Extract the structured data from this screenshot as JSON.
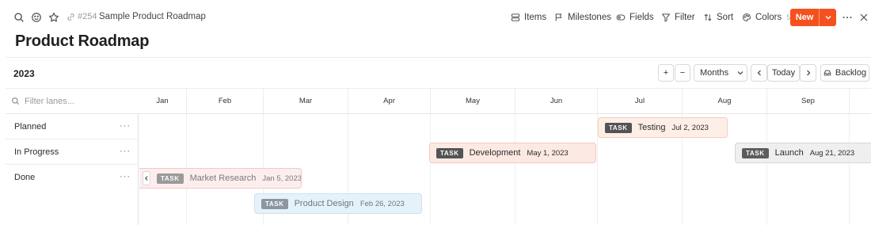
{
  "breadcrumb": {
    "page_ref": "#254",
    "title": "Sample Product Roadmap"
  },
  "toolbar": {
    "items": "Items",
    "milestones": "Milestones",
    "fields": "Fields",
    "filter": "Filter",
    "sort": "Sort",
    "colors": "Colors",
    "colors_count": "5",
    "new": "New"
  },
  "page_title": "Product Roadmap",
  "timeline": {
    "year": "2023",
    "zoom_plus": "+",
    "zoom_minus": "−",
    "scale": "Months",
    "today": "Today",
    "backlog": "Backlog",
    "filter_placeholder": "Filter lanes...",
    "months": [
      "Jan",
      "Feb",
      "Mar",
      "Apr",
      "May",
      "Jun",
      "Jul",
      "Aug",
      "Sep"
    ]
  },
  "lanes": [
    {
      "label": "Planned",
      "more": "···"
    },
    {
      "label": "In Progress",
      "more": "···"
    },
    {
      "label": "Done",
      "more": "···"
    }
  ],
  "tasks": [
    {
      "tag": "TASK",
      "name": "Testing",
      "date": "Jul 2, 2023",
      "lane": "Planned"
    },
    {
      "tag": "TASK",
      "name": "Development",
      "date": "May 1, 2023",
      "lane": "In Progress"
    },
    {
      "tag": "TASK",
      "name": "Launch",
      "date": "Aug 21, 2023",
      "lane": "In Progress"
    },
    {
      "tag": "TASK",
      "name": "Market Research",
      "date": "Jan 5, 2023",
      "lane": "Done"
    },
    {
      "tag": "TASK",
      "name": "Product Design",
      "date": "Feb 26, 2023",
      "lane": "Done"
    }
  ],
  "colors": {
    "accent": "#f4511e"
  },
  "icons": [
    "search-icon",
    "emoji-icon",
    "star-icon",
    "link-icon",
    "items-icon",
    "flag-icon",
    "fields-icon",
    "filter-icon",
    "sort-icon",
    "palette-icon",
    "chevron-down-icon",
    "more-icon",
    "close-icon",
    "chevron-left-icon",
    "chevron-right-icon",
    "backlog-icon"
  ]
}
